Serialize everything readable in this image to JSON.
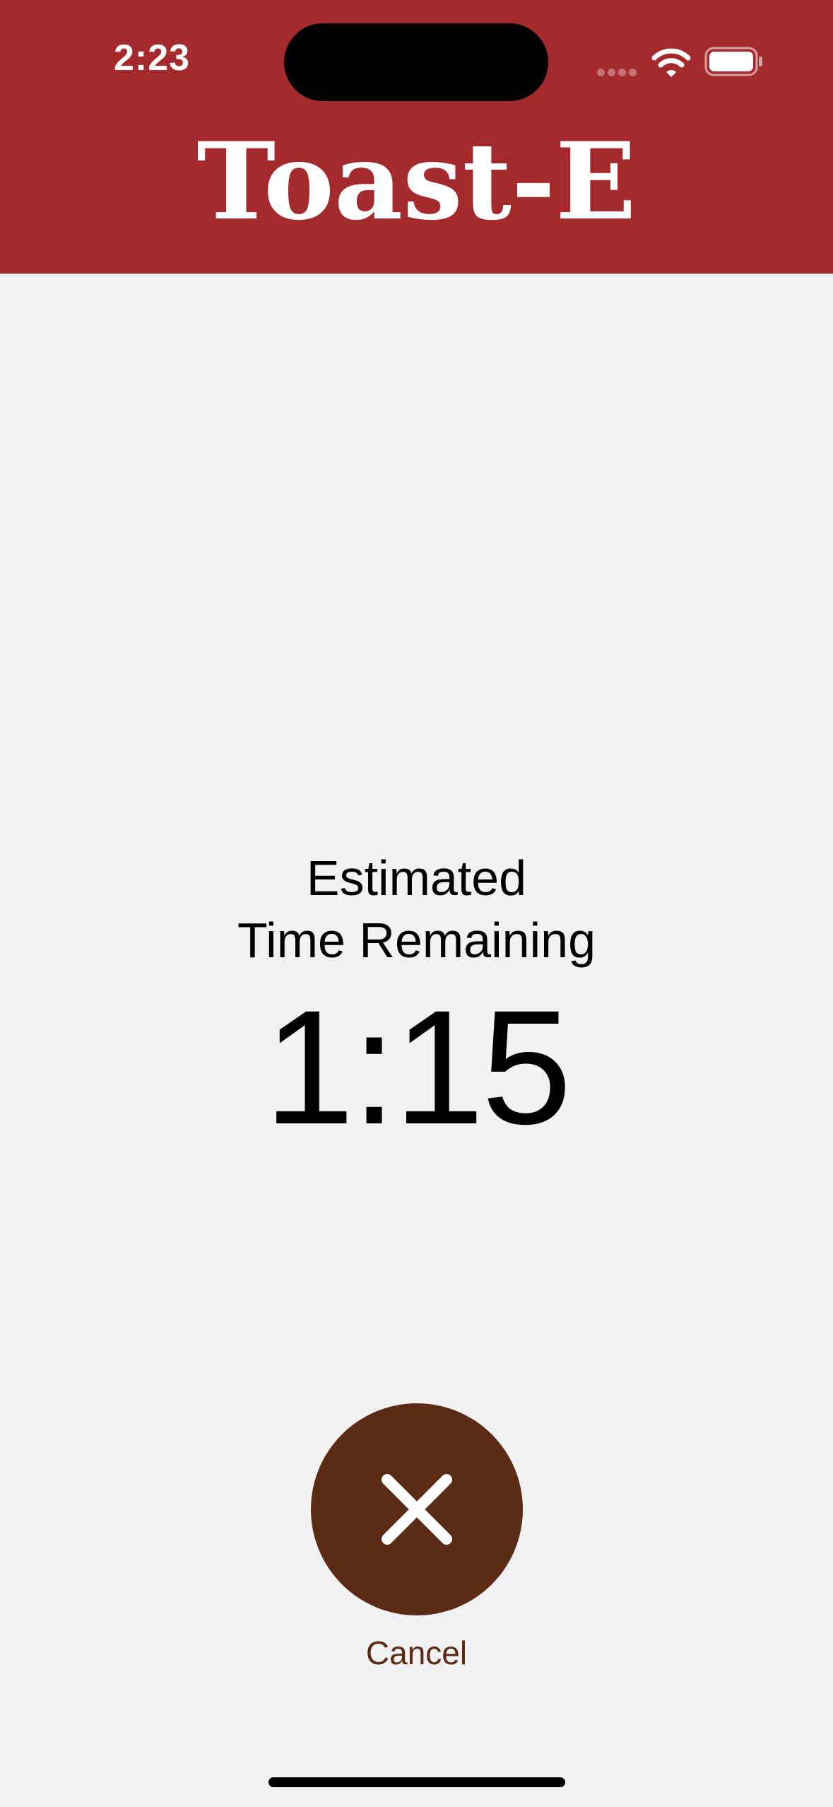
{
  "status_bar": {
    "time": "2:23",
    "signal_icon": "cellular-signal-icon",
    "wifi_icon": "wifi-icon",
    "battery_icon": "battery-icon"
  },
  "header": {
    "title": "Toast-E",
    "background_color": "#a52a2d"
  },
  "main": {
    "estimated_label": "Estimated",
    "time_remaining_label": "Time Remaining",
    "timer_value": "1:15"
  },
  "actions": {
    "cancel_icon": "close-icon",
    "cancel_label": "Cancel",
    "cancel_color": "#5c2b16"
  }
}
